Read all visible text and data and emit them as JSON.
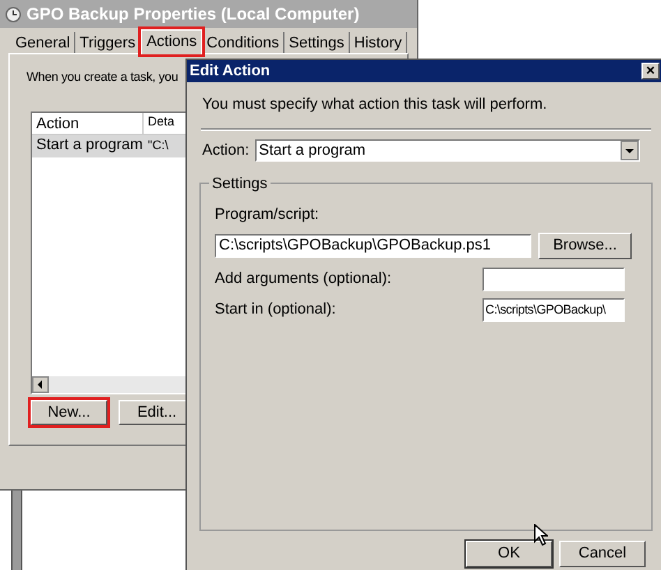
{
  "back_window": {
    "title": "GPO Backup Properties (Local Computer)",
    "tabs": [
      {
        "label": "General",
        "selected": false,
        "highlighted": false
      },
      {
        "label": "Triggers",
        "selected": false,
        "highlighted": false
      },
      {
        "label": "Actions",
        "selected": true,
        "highlighted": true
      },
      {
        "label": "Conditions",
        "selected": false,
        "highlighted": false
      },
      {
        "label": "Settings",
        "selected": false,
        "highlighted": false
      },
      {
        "label": "History",
        "selected": false,
        "highlighted": false
      }
    ],
    "intro": "When you create a task, you",
    "table": {
      "columns": [
        "Action",
        "Deta"
      ],
      "rows": [
        {
          "cells": [
            "Start a program",
            "\"C:\\"
          ],
          "selected": true
        }
      ]
    },
    "buttons": [
      {
        "label": "New...",
        "highlighted": true
      },
      {
        "label": "Edit...",
        "highlighted": false
      }
    ]
  },
  "dialog": {
    "title": "Edit Action",
    "close": "×",
    "instruction": "You must specify what action this task will perform.",
    "action": {
      "label": "Action:",
      "value": "Start a program"
    },
    "settings": {
      "title": "Settings",
      "program": {
        "label": "Program/script:",
        "value": "C:\\scripts\\GPOBackup\\GPOBackup.ps1",
        "button": "Browse..."
      },
      "arguments": {
        "label": "Add arguments (optional):"
      },
      "start_in": {
        "label": "Start in (optional):",
        "value": "C:\\scripts\\GPOBackup\\"
      }
    },
    "buttons": [
      "OK",
      "Cancel"
    ]
  }
}
